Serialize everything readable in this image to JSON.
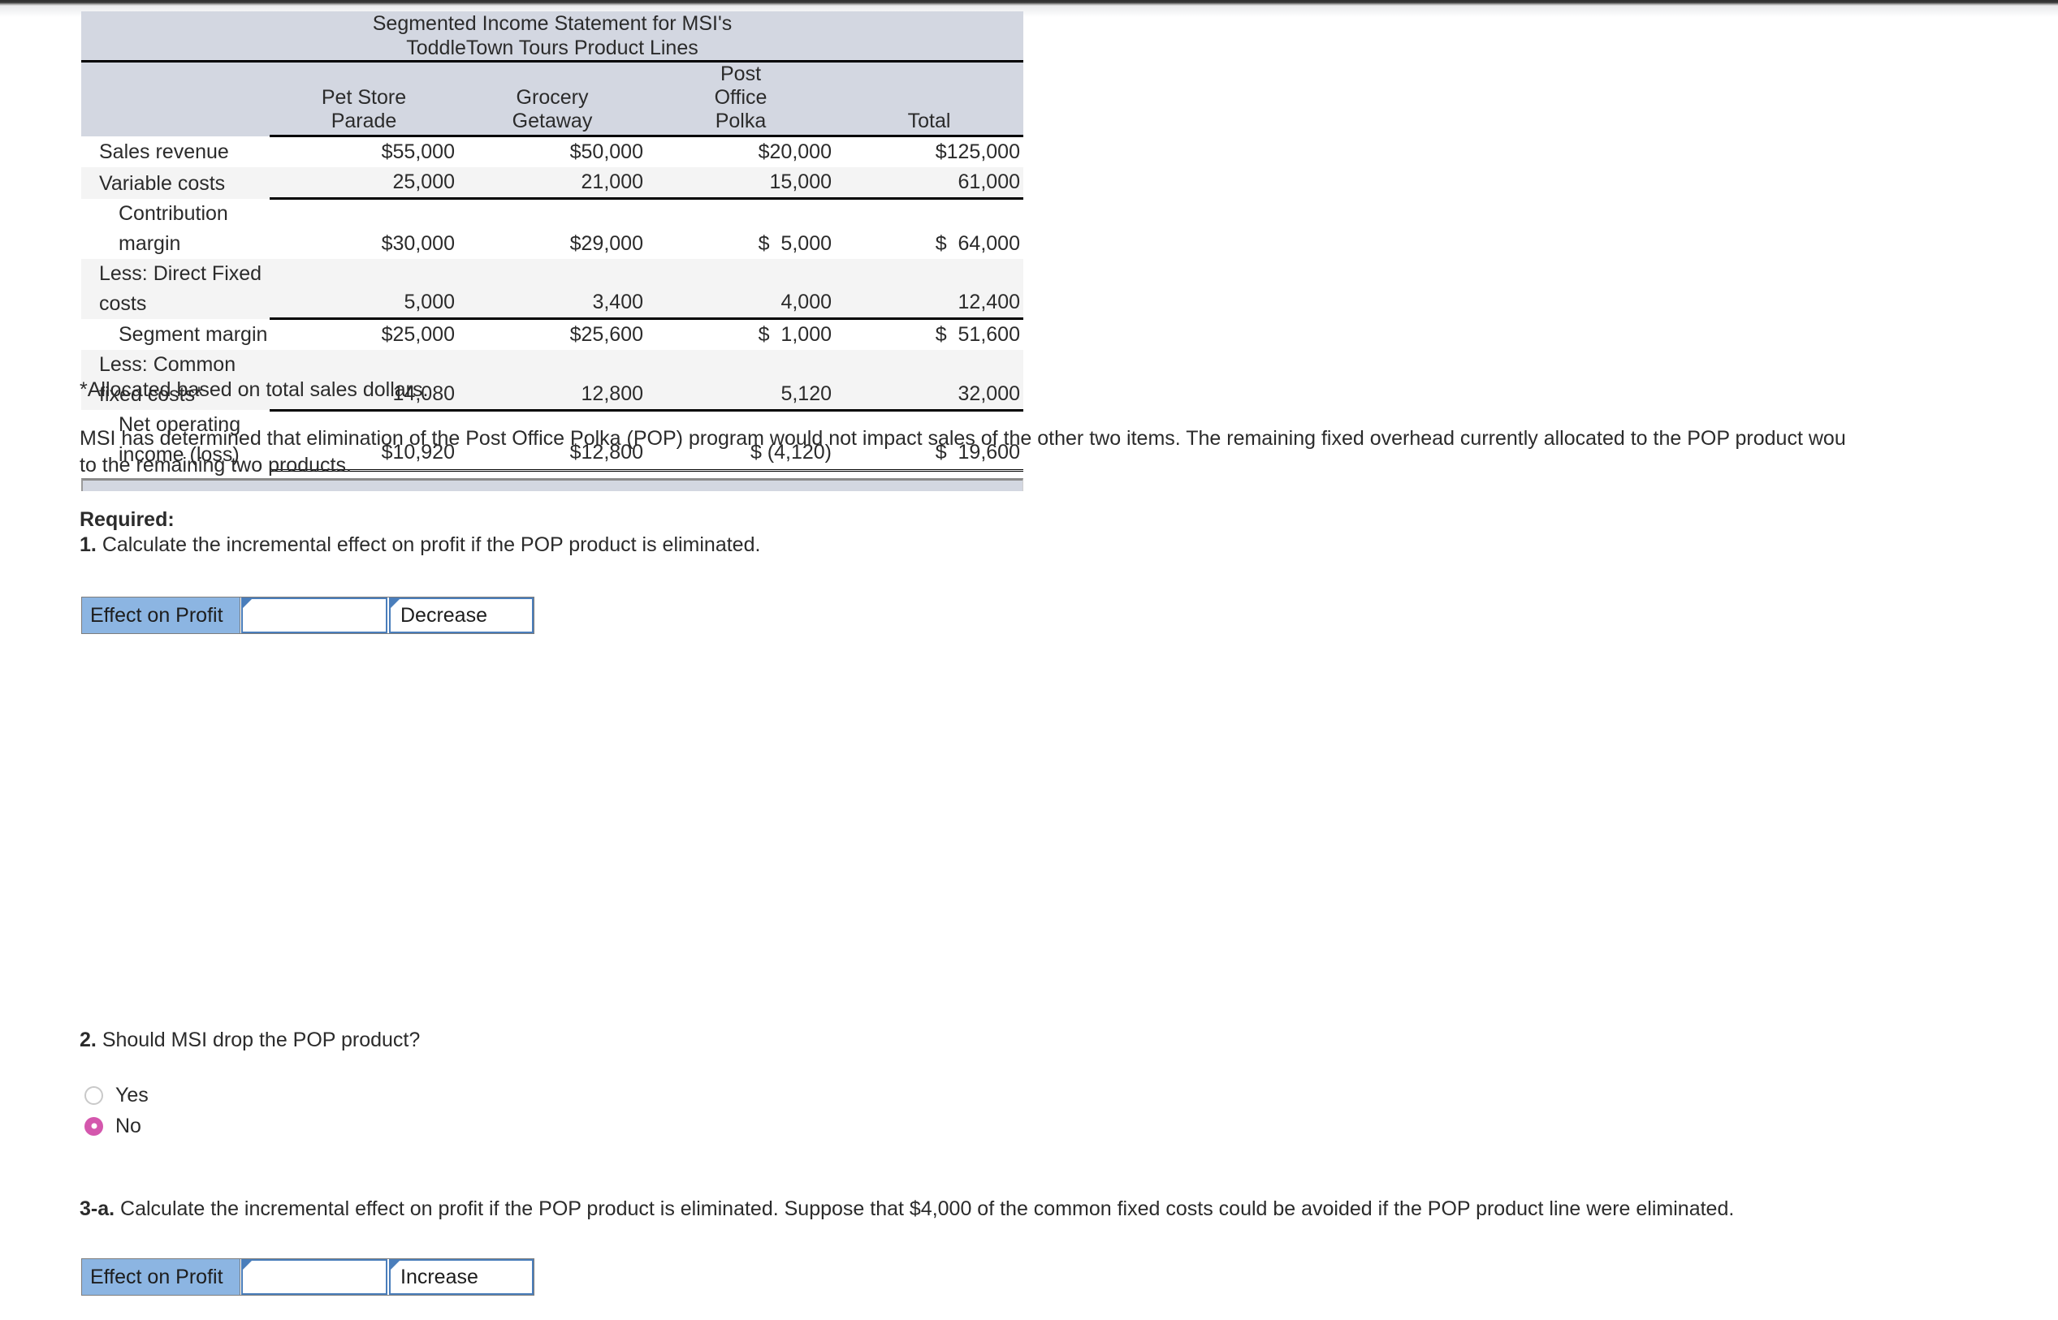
{
  "exhibit": {
    "title_line1": "Segmented Income Statement for MSI's",
    "title_line2": "ToddleTown Tours Product Lines",
    "columns": [
      {
        "line1": "",
        "line2": "Pet Store",
        "line3": "Parade"
      },
      {
        "line1": "",
        "line2": "Grocery",
        "line3": "Getaway"
      },
      {
        "line1": "Post",
        "line2": "Office",
        "line3": "Polka"
      },
      {
        "line1": "",
        "line2": "",
        "line3": "Total"
      }
    ],
    "rows": [
      {
        "label": "Sales revenue",
        "pet": "$55,000",
        "grocery": "$50,000",
        "post": "$20,000",
        "total": "$125,000"
      },
      {
        "label": "Variable costs",
        "pet": "25,000",
        "grocery": "21,000",
        "post": "15,000",
        "total": "61,000"
      },
      {
        "label": "Contribution margin",
        "pet": "$30,000",
        "grocery": "$29,000",
        "post": "$  5,000",
        "total": "$  64,000"
      },
      {
        "label": "Less: Direct Fixed costs",
        "pet": "5,000",
        "grocery": "3,400",
        "post": "4,000",
        "total": "12,400"
      },
      {
        "label": "Segment margin",
        "pet": "$25,000",
        "grocery": "$25,600",
        "post": "$  1,000",
        "total": "$  51,600"
      },
      {
        "label": "Less: Common fixed costs*",
        "pet": "14,080",
        "grocery": "12,800",
        "post": "5,120",
        "total": "32,000"
      },
      {
        "label": "Net operating income (loss)",
        "pet": "$10,920",
        "grocery": "$12,800",
        "post": "$ (4,120)",
        "total": "$  19,600"
      }
    ]
  },
  "footnote": "*Allocated based on total sales dollars.",
  "paragraph": {
    "line1": "MSI has determined that elimination of the Post Office Polka (POP) program would not impact sales of the other two items. The remaining fixed overhead currently allocated to the POP product wou",
    "line2": "to the remaining two products."
  },
  "required_heading": "Required:",
  "question1": {
    "number": "1.",
    "text": "Calculate the incremental effect on profit if the POP product is eliminated."
  },
  "answer1": {
    "label": "Effect on Profit",
    "value": "",
    "placeholder": "",
    "direction": "Decrease"
  },
  "question2": {
    "number": "2.",
    "text": "Should MSI drop the POP product?",
    "options": [
      {
        "label": "Yes",
        "selected": false
      },
      {
        "label": "No",
        "selected": true
      }
    ]
  },
  "question3a": {
    "number": "3-a.",
    "text": "Calculate the incremental effect on profit if the POP product is eliminated. Suppose that $4,000 of the common fixed costs could be avoided if the POP product line were eliminated."
  },
  "answer3a": {
    "label": "Effect on Profit",
    "value": "",
    "placeholder": "",
    "direction": "Increase"
  },
  "colors": {
    "header_bg": "#d3d7e1",
    "label_blue": "#8cb5e2",
    "cell_border_blue": "#4a7ebb",
    "radio_selected": "#d457ad",
    "alt_row": "#f4f4f4"
  }
}
